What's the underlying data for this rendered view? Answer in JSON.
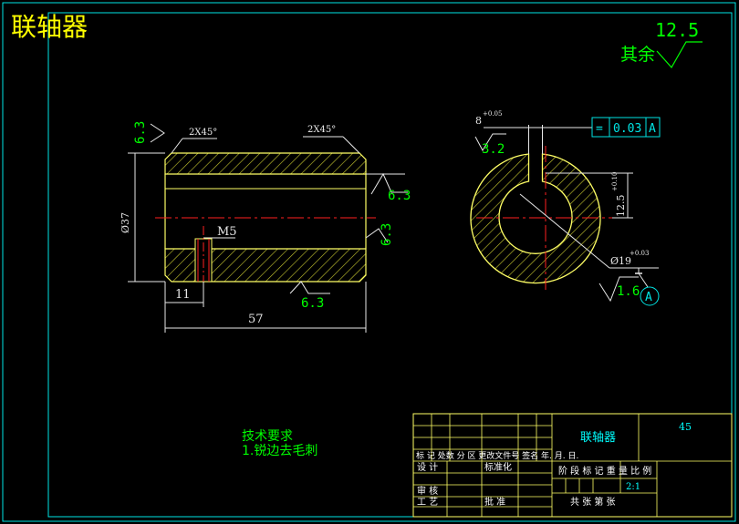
{
  "drawing": {
    "title": "联轴器",
    "colors": {
      "background": "#000000",
      "frame": "#00e5e5",
      "part_outline": "#ffff66",
      "centerline": "#ff2020",
      "dimension": "#e8e8e8",
      "roughness_text": "#00ff00",
      "title_text": "#ffff00",
      "hatch": "#c8c830",
      "table_line": "#ffff66",
      "table_text": "#ffffff",
      "table_cyan_text": "#00ffff"
    }
  },
  "general_roughness": {
    "value": "12.5",
    "label": "其余"
  },
  "front_view": {
    "chamfer_left": "2X45°",
    "chamfer_right": "2X45°",
    "roughness_top_left": "6.3",
    "roughness_right_upper": "6.3",
    "roughness_right_lower": "6.3",
    "roughness_bottom": "6.3",
    "diameter": "Ø37",
    "thread": "M5",
    "dim_hole_pos": "11",
    "dim_length": "57"
  },
  "side_view": {
    "keyway_width": "8",
    "keyway_tol": "+0.05",
    "roughness_keyway": "3.2",
    "tolerance_frame_symbol": "=",
    "tolerance_frame_value": "0.03",
    "tolerance_frame_datum": "A",
    "keyway_depth": "12.5",
    "keyway_depth_tol": "+0.10",
    "bore_diameter": "Ø19",
    "bore_tol": "+0.03",
    "roughness_bore": "1.6",
    "datum": "A"
  },
  "notes": {
    "heading": "技术要求",
    "line1": "1.锐边去毛刺"
  },
  "title_block": {
    "part_name": "联轴器",
    "material": "45",
    "row_label": "标 记 处数  分 区  更改文件号  签名  年. 月. 日.",
    "design": "设 计",
    "standardize": "标准化",
    "stage_label": "阶 段 标 记   重 量  比 例",
    "scale": "2:1",
    "review": "审 核",
    "process": "工 艺",
    "approve": "批 准",
    "sheet_label": "共   张  第   张"
  }
}
